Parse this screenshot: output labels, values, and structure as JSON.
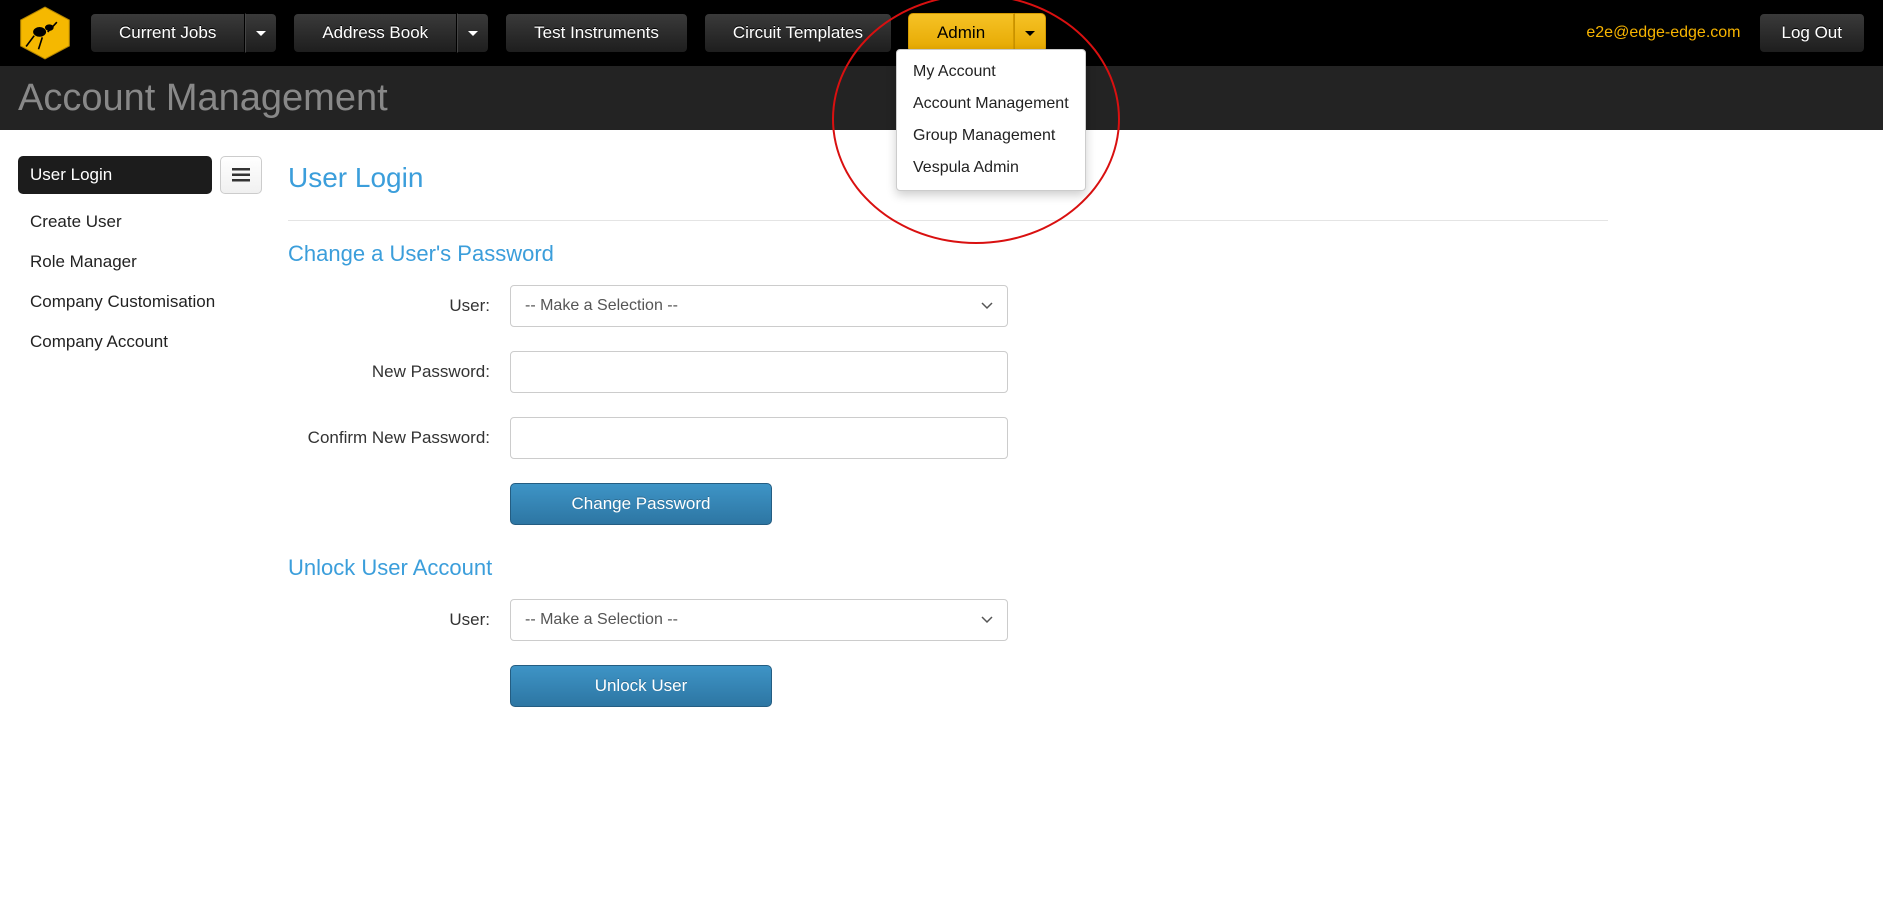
{
  "nav": {
    "current_jobs": "Current Jobs",
    "address_book": "Address Book",
    "test_instruments": "Test Instruments",
    "circuit_templates": "Circuit Templates",
    "admin": "Admin"
  },
  "dropdown": {
    "my_account": "My Account",
    "account_management": "Account Management",
    "group_management": "Group Management",
    "vespula_admin": "Vespula Admin"
  },
  "user_email": "e2e@edge-edge.com",
  "logout": "Log Out",
  "page_title": "Account Management",
  "sidebar": {
    "active": "User Login",
    "items": {
      "create_user": "Create User",
      "role_manager": "Role Manager",
      "company_customisation": "Company Customisation",
      "company_account": "Company Account"
    }
  },
  "content": {
    "heading": "User Login",
    "change_pw": {
      "title": "Change a User's Password",
      "user_label": "User:",
      "user_placeholder": "-- Make a Selection --",
      "new_pw_label": "New Password:",
      "confirm_pw_label": "Confirm New Password:",
      "button": "Change Password"
    },
    "unlock": {
      "title": "Unlock User Account",
      "user_label": "User:",
      "user_placeholder": "-- Make a Selection --",
      "button": "Unlock User"
    }
  }
}
